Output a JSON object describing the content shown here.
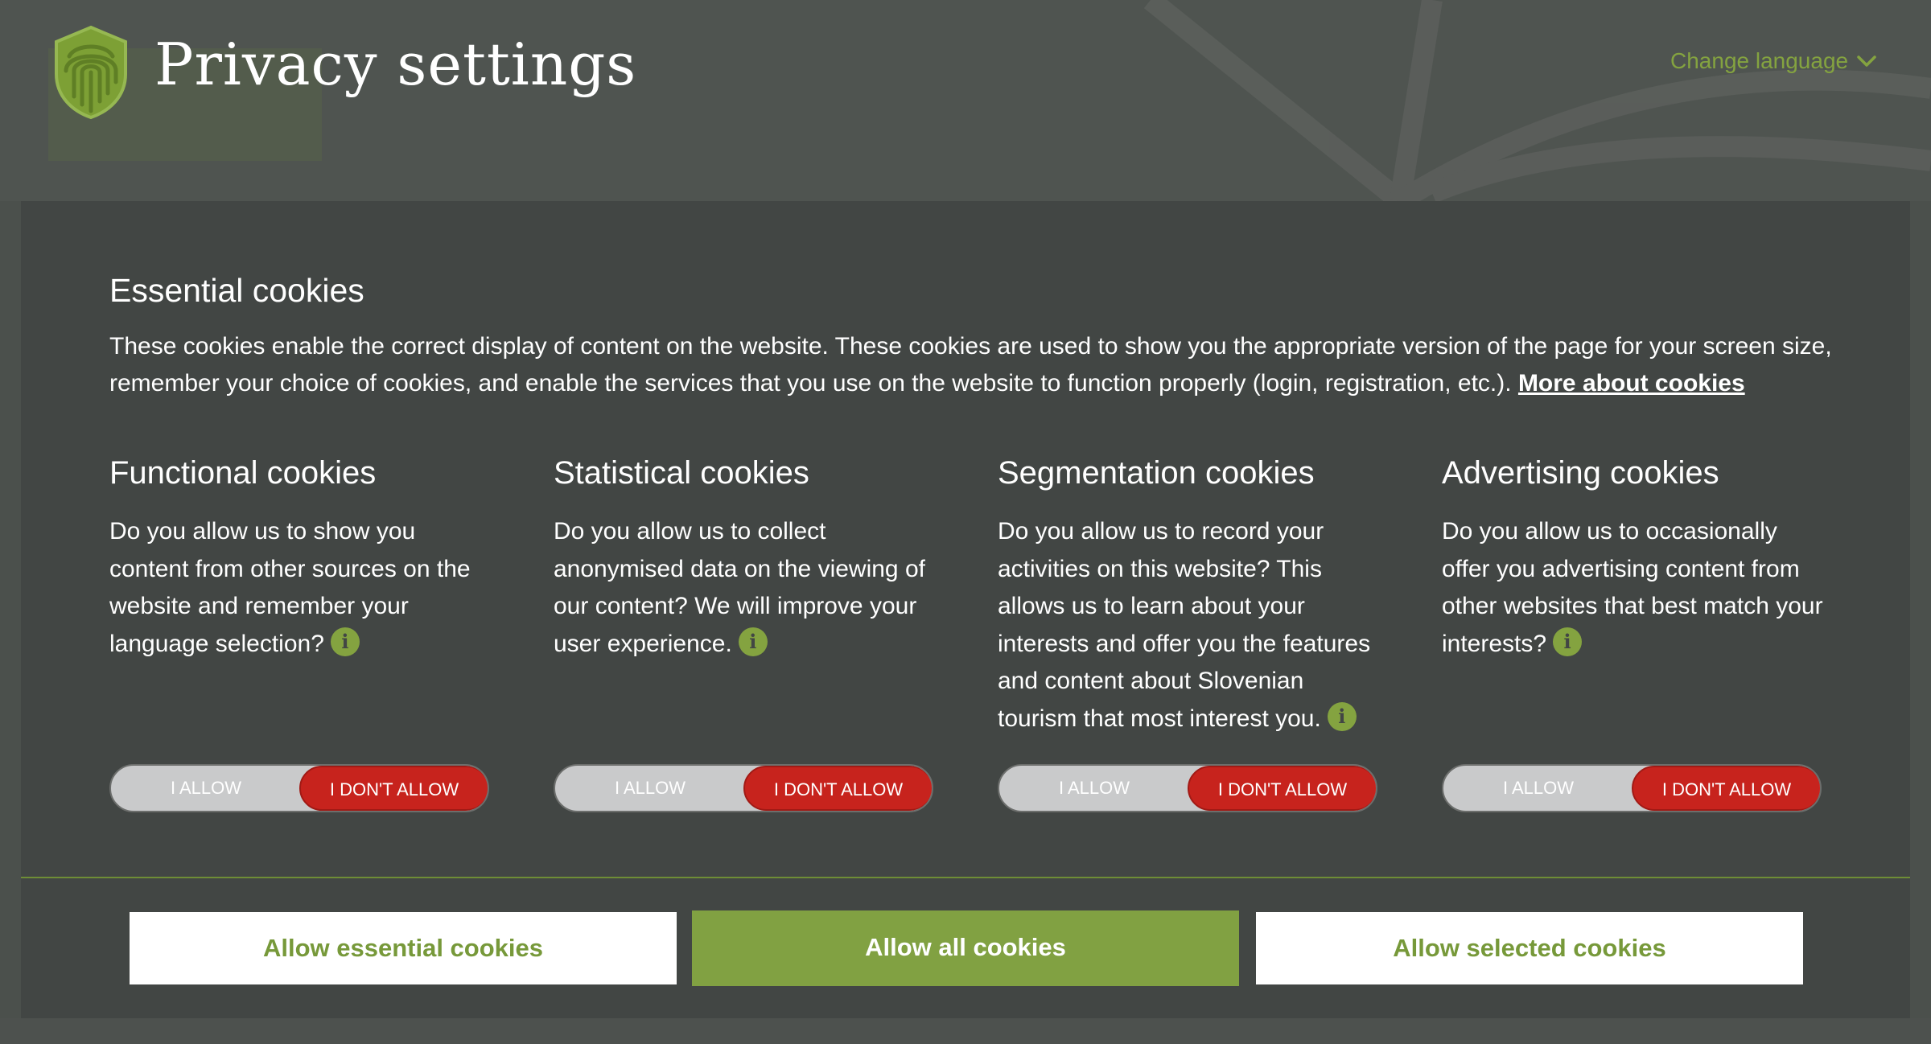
{
  "header": {
    "title": "Privacy settings",
    "change_language": "Change language"
  },
  "essential": {
    "title": "Essential cookies",
    "text": "These cookies enable the correct display of content on the website. These cookies are used to show you the appropriate version of the page for your screen size, remember your choice of cookies, and enable the services that you use on the website to function properly (login, registration, etc.).",
    "more_link": "More about cookies"
  },
  "categories": [
    {
      "title": "Functional cookies",
      "text": "Do you allow us to show you content from other sources on the website and remember your language selection?",
      "allow_label": "I ALLOW",
      "deny_label": "I DON'T ALLOW",
      "selected": "deny"
    },
    {
      "title": "Statistical cookies",
      "text": "Do you allow us to collect anonymised data on the viewing of our content? We will improve your user experience.",
      "allow_label": "I ALLOW",
      "deny_label": "I DON'T ALLOW",
      "selected": "deny"
    },
    {
      "title": "Segmentation cookies",
      "text": "Do you allow us to record your activities on this website? This allows us to learn about your interests and offer you the features and content about Slovenian tourism that most interest you.",
      "allow_label": "I ALLOW",
      "deny_label": "I DON'T ALLOW",
      "selected": "deny"
    },
    {
      "title": "Advertising cookies",
      "text": "Do you allow us to occasionally offer you advertising content from other websites that best match your interests?",
      "allow_label": "I ALLOW",
      "deny_label": "I DON'T ALLOW",
      "selected": "deny"
    }
  ],
  "actions": {
    "essential": "Allow essential cookies",
    "all": "Allow all cookies",
    "selected": "Allow selected cookies"
  },
  "colors": {
    "accent_green": "#81a142",
    "deny_red": "#c7231d",
    "panel_bg": "#424644"
  },
  "icons": {
    "logo": "shield-fingerprint-icon",
    "chevron": "chevron-down-icon",
    "info": "info-icon"
  }
}
